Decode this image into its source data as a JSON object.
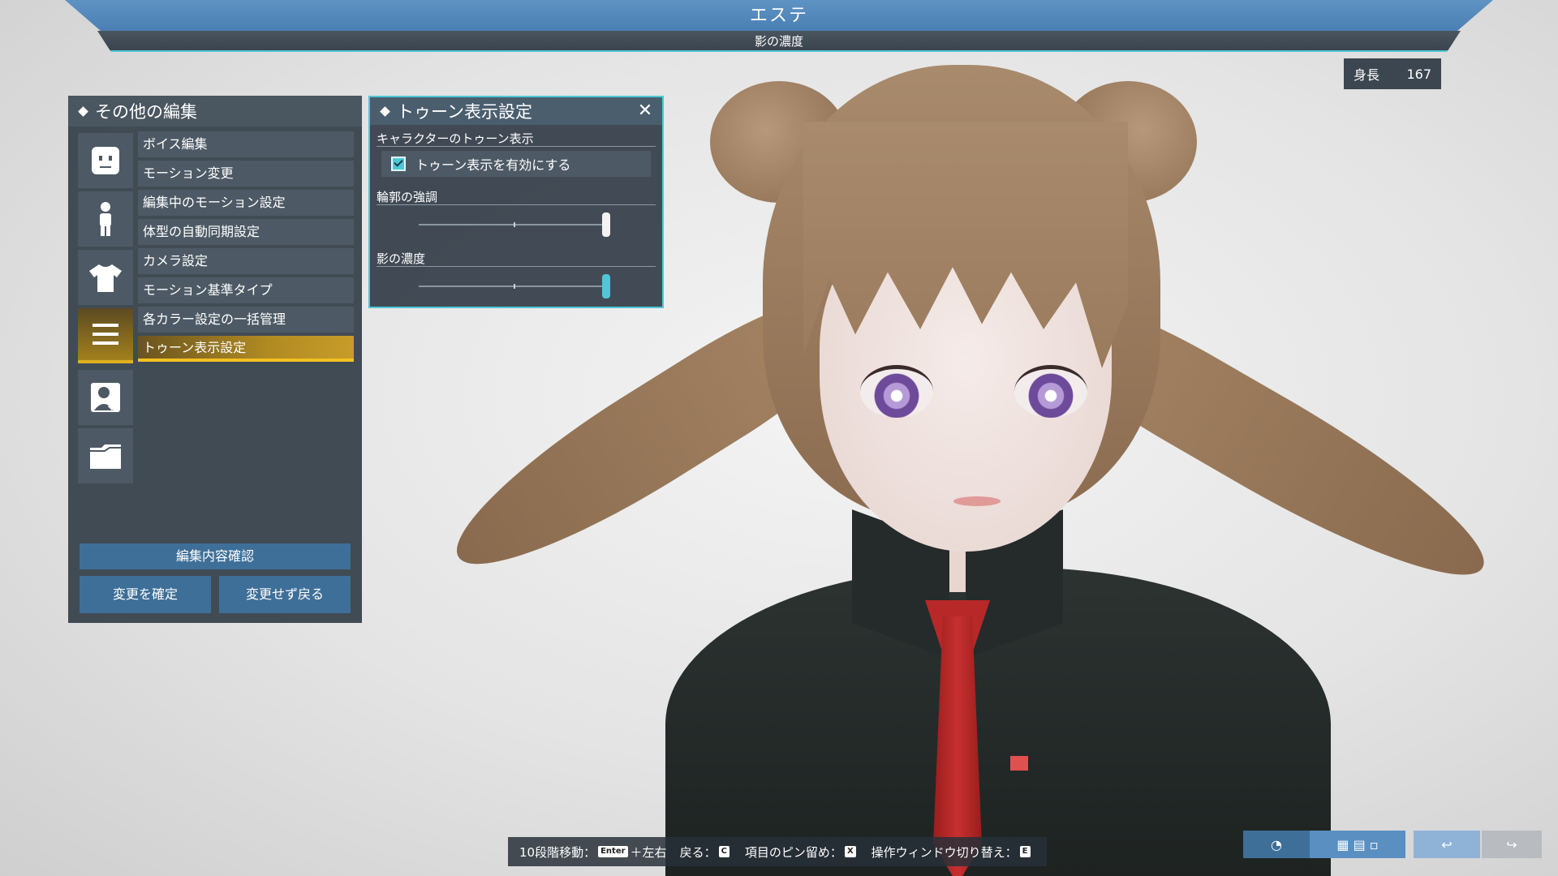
{
  "header": {
    "title": "エステ",
    "subtitle": "影の濃度"
  },
  "height": {
    "label": "身長",
    "value": "167"
  },
  "left_panel": {
    "title": "その他の編集",
    "categories": [
      {
        "icon": "face-icon"
      },
      {
        "icon": "body-icon"
      },
      {
        "icon": "shirt-icon"
      },
      {
        "icon": "menu-lines-icon",
        "active": true
      },
      {
        "icon": "person-check-icon"
      },
      {
        "icon": "folder-icon"
      }
    ],
    "items": [
      {
        "label": "ボイス編集"
      },
      {
        "label": "モーション変更"
      },
      {
        "label": "編集中のモーション設定"
      },
      {
        "label": "体型の自動同期設定"
      },
      {
        "label": "カメラ設定"
      },
      {
        "label": "モーション基準タイプ"
      },
      {
        "label": "各カラー設定の一括管理"
      },
      {
        "label": "トゥーン表示設定",
        "active": true
      }
    ],
    "confirm_button": "編集内容確認",
    "apply_button": "変更を確定",
    "cancel_button": "変更せず戻る"
  },
  "toon_window": {
    "title": "トゥーン表示設定",
    "section1_label": "キャラクターのトゥーン表示",
    "checkbox_label": "トゥーン表示を有効にする",
    "checkbox_checked": true,
    "section2_label": "輪郭の強調",
    "outline_value": 1.0,
    "section3_label": "影の濃度",
    "shadow_value": 1.0
  },
  "help_bar": {
    "step_move": "10段階移動：",
    "enter_key": "Enter",
    "left_right": "＋左右",
    "back": "戻る：",
    "back_key": "C",
    "pin": "項目のピン留め：",
    "pin_key": "X",
    "switch": "操作ウィンドウ切り替え：",
    "switch_key": "E"
  },
  "colors": {
    "accent_cyan": "#4fc7d8",
    "active_gold": "#f2c020",
    "button_blue": "#3e6f98",
    "panel": "#38424c"
  }
}
